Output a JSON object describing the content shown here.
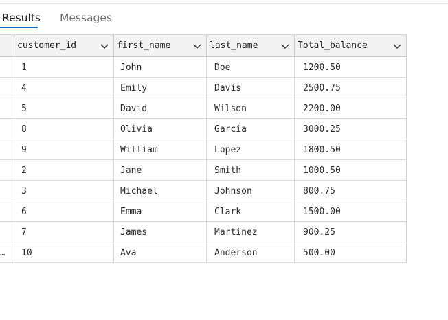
{
  "tabs": {
    "results_label": "Results",
    "messages_label": "Messages"
  },
  "grid": {
    "columns": [
      "customer_id",
      "first_name",
      "last_name",
      "Total_balance"
    ],
    "rows": [
      {
        "customer_id": "1",
        "first_name": "John",
        "last_name": "Doe",
        "total_balance": "1200.50"
      },
      {
        "customer_id": "4",
        "first_name": "Emily",
        "last_name": "Davis",
        "total_balance": "2500.75"
      },
      {
        "customer_id": "5",
        "first_name": "David",
        "last_name": "Wilson",
        "total_balance": "2200.00"
      },
      {
        "customer_id": "8",
        "first_name": "Olivia",
        "last_name": "Garcia",
        "total_balance": "3000.25"
      },
      {
        "customer_id": "9",
        "first_name": "William",
        "last_name": "Lopez",
        "total_balance": "1800.50"
      },
      {
        "customer_id": "2",
        "first_name": "Jane",
        "last_name": "Smith",
        "total_balance": "1000.50"
      },
      {
        "customer_id": "3",
        "first_name": "Michael",
        "last_name": "Johnson",
        "total_balance": "800.75"
      },
      {
        "customer_id": "6",
        "first_name": "Emma",
        "last_name": "Clark",
        "total_balance": "1500.00"
      },
      {
        "customer_id": "7",
        "first_name": "James",
        "last_name": "Martinez",
        "total_balance": "900.25"
      },
      {
        "customer_id": "10",
        "first_name": "Ava",
        "last_name": "Anderson",
        "total_balance": "500.00"
      }
    ],
    "row_selector_marker": "…",
    "header_icon": "chevron-down-icon"
  },
  "colors": {
    "accent": "#0f6cbd",
    "header_bg": "#f3f3f3",
    "inactive_tab": "#6f6f6f"
  }
}
